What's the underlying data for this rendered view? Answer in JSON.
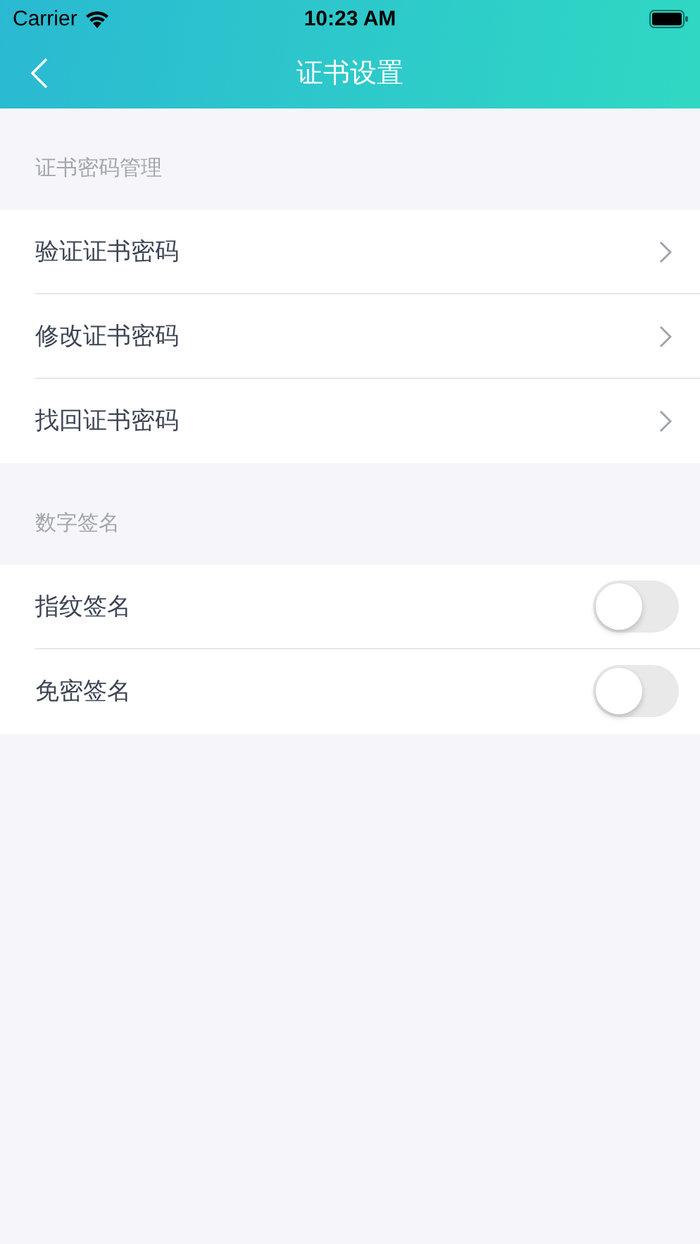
{
  "status_bar": {
    "carrier": "Carrier",
    "time": "10:23 AM"
  },
  "nav_bar": {
    "title": "证书设置"
  },
  "sections": [
    {
      "header": "证书密码管理",
      "items": [
        {
          "kind": "link",
          "label": "验证证书密码"
        },
        {
          "kind": "link",
          "label": "修改证书密码"
        },
        {
          "kind": "link",
          "label": "找回证书密码"
        }
      ]
    },
    {
      "header": "数字签名",
      "items": [
        {
          "kind": "switch",
          "label": "指纹签名",
          "on": false
        },
        {
          "kind": "switch",
          "label": "免密签名",
          "on": false
        }
      ]
    }
  ]
}
